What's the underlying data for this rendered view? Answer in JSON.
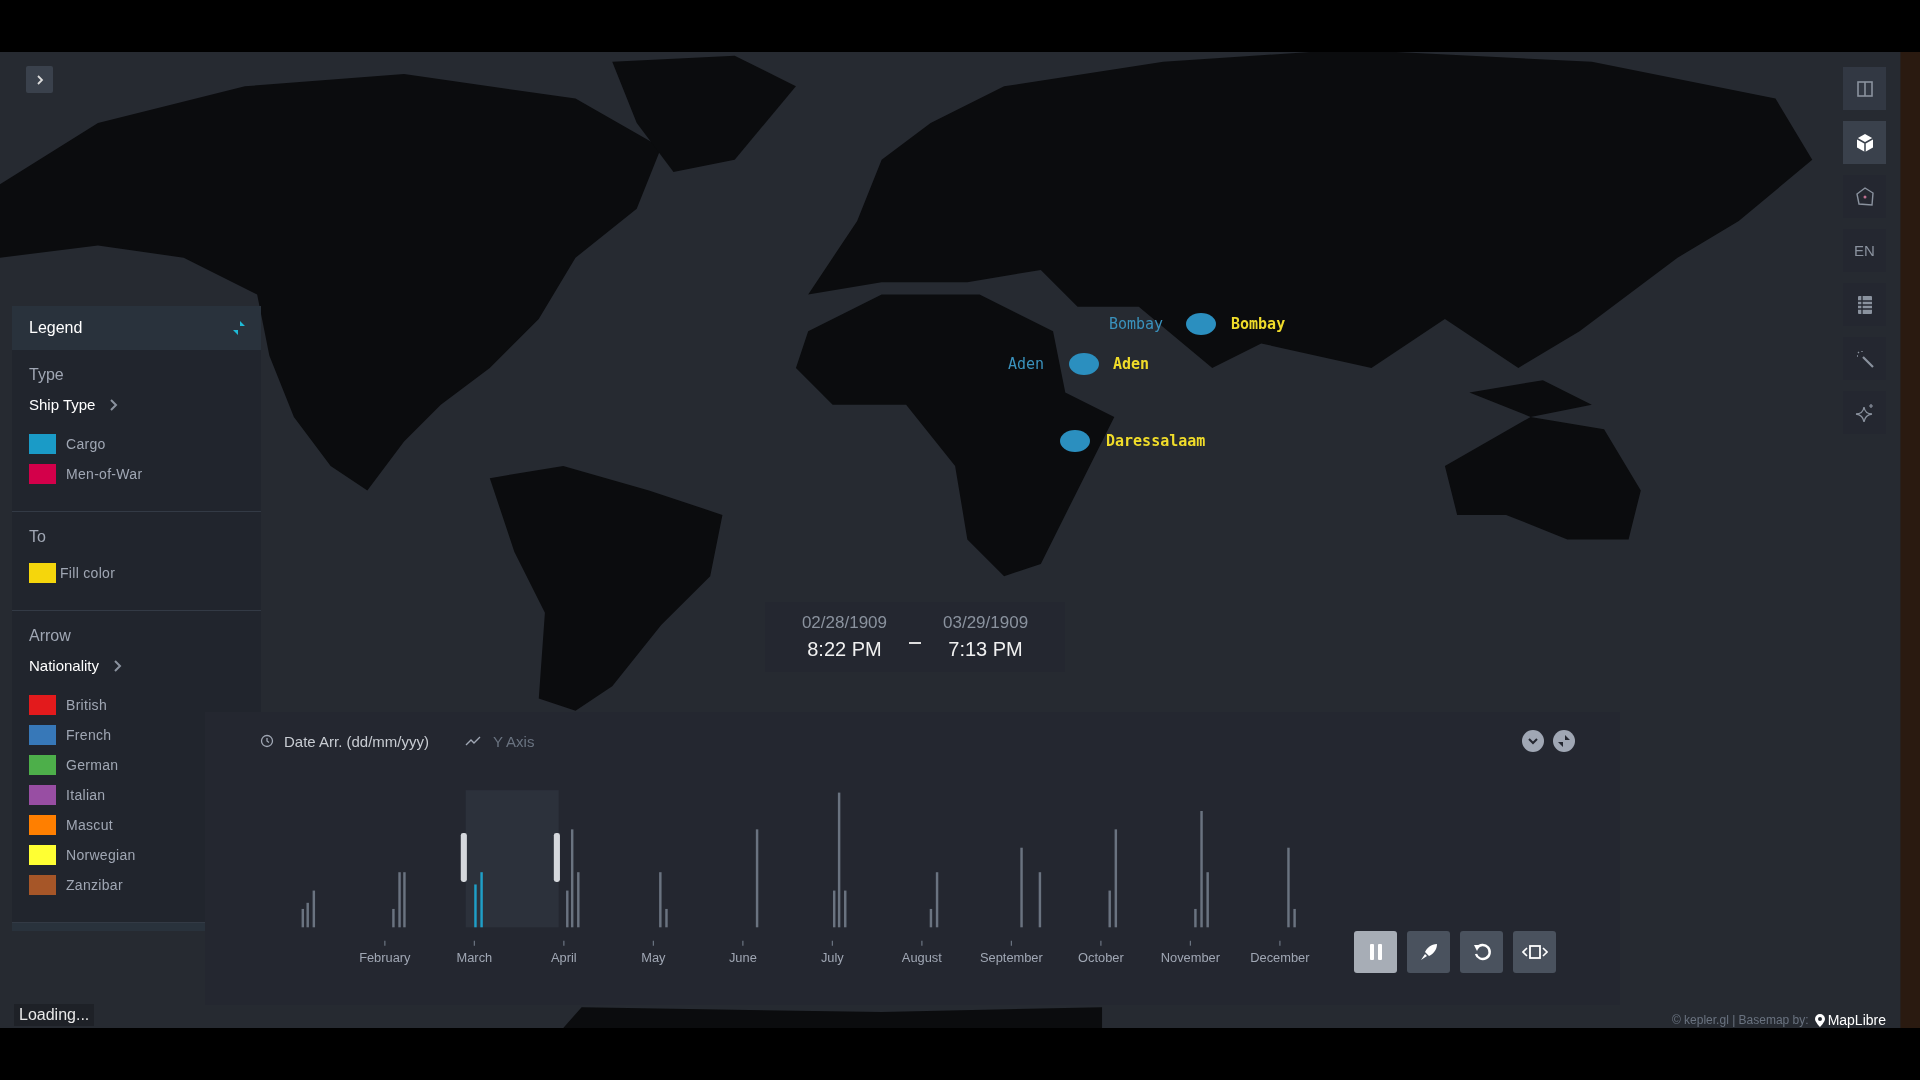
{
  "legend": {
    "title": "Legend",
    "sections": [
      {
        "title": "Type",
        "field": "Ship Type",
        "items": [
          {
            "label": "Cargo",
            "color": "#1a9bc7"
          },
          {
            "label": "Men-of-War",
            "color": "#d3004a"
          }
        ]
      },
      {
        "title": "To",
        "items": [
          {
            "label": "Fill color",
            "color": "#f5d60c"
          }
        ]
      },
      {
        "title": "Arrow",
        "field": "Nationality",
        "items": [
          {
            "label": "British",
            "color": "#e31a1c"
          },
          {
            "label": "French",
            "color": "#3778b8"
          },
          {
            "label": "German",
            "color": "#4daf4a"
          },
          {
            "label": "Italian",
            "color": "#984ea3"
          },
          {
            "label": "Mascut",
            "color": "#ff7f00"
          },
          {
            "label": "Norwegian",
            "color": "#ffff33"
          },
          {
            "label": "Zanzibar",
            "color": "#a65628"
          }
        ]
      }
    ]
  },
  "map": {
    "places": [
      {
        "source": "Bombay",
        "target": "Bombay"
      },
      {
        "source": "Aden",
        "target": "Aden"
      },
      {
        "target": "Daressalaam"
      }
    ]
  },
  "toolbar": [
    {
      "kind": "split",
      "selected": false
    },
    {
      "kind": "cube",
      "selected": true
    },
    {
      "kind": "draw",
      "selected": false
    },
    {
      "kind": "lang",
      "label": "EN",
      "selected": false
    },
    {
      "kind": "table",
      "selected": false
    },
    {
      "kind": "wand",
      "selected": false
    },
    {
      "kind": "sparkle",
      "selected": false
    }
  ],
  "time_range": {
    "start_date": "02/28/1909",
    "start_time": "8:22 PM",
    "end_date": "03/29/1909",
    "end_time": "7:13 PM"
  },
  "timeline": {
    "field": "Date Arr. (dd/mm/yyy)",
    "y_axis": "Y Axis",
    "playing": true,
    "months": [
      "February",
      "March",
      "April",
      "May",
      "June",
      "July",
      "August",
      "September",
      "October",
      "November",
      "December"
    ],
    "controls": [
      {
        "kind": "play"
      },
      {
        "kind": "speed"
      },
      {
        "kind": "reset"
      },
      {
        "kind": "window"
      }
    ]
  },
  "status": "Loading...",
  "attribution": {
    "text": "© kepler.gl | Basemap by:",
    "brand": "MapLibre"
  }
}
